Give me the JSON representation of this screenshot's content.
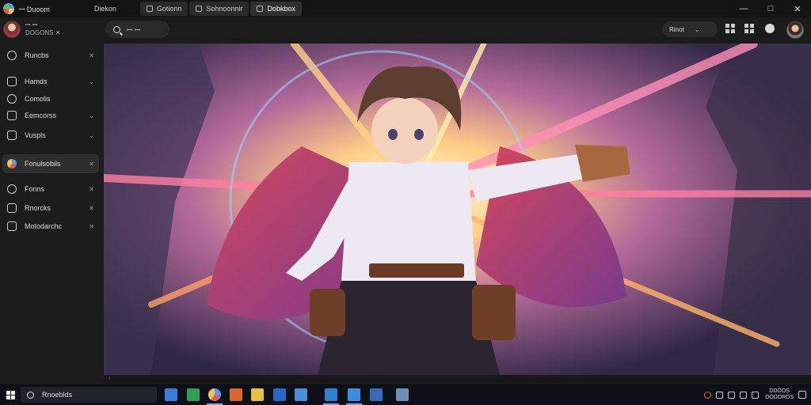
{
  "titlebar": {
    "app_name": "ꟷ Duoom",
    "tabs": [
      {
        "label": "Diekon"
      },
      {
        "label": "Gotionn"
      },
      {
        "label": "Sohnoonnir"
      },
      {
        "label": "Dobkbox"
      }
    ],
    "controls": {
      "minimize": "—",
      "maximize": "□",
      "close": "✕"
    }
  },
  "profile": {
    "name": "ꟷ ꟷ",
    "subtitle": "DOGONS ✕"
  },
  "sidebar": {
    "items": [
      {
        "label": "Runcbs",
        "icon": "history-icon",
        "caret": "✕"
      },
      {
        "label": "Hamds",
        "icon": "star-icon",
        "caret": "⌄"
      },
      {
        "label": "Comolis",
        "icon": "circle-icon",
        "caret": ""
      },
      {
        "label": "Eemcorss",
        "icon": "folder-icon",
        "caret": "⌄"
      },
      {
        "label": "Vuspls",
        "icon": "tag-icon",
        "caret": "⌄"
      },
      {
        "label": "Fonulsobils",
        "icon": "globe-icon",
        "caret": "✕"
      },
      {
        "label": "Fonns",
        "icon": "palette-icon",
        "caret": "✕"
      },
      {
        "label": "Rnorcks",
        "icon": "puzzle-icon",
        "caret": "✕"
      },
      {
        "label": "Motodarchc",
        "icon": "shield-icon",
        "caret": "✕"
      }
    ]
  },
  "header": {
    "search_placeholder": "ꟷ ꟷ",
    "filter_label": "Rinot",
    "filter_caret": "⌄"
  },
  "taskbar": {
    "search_text": "Rnoeblds",
    "clock_time": "DDOOS",
    "clock_date": "DODORDS"
  },
  "colors": {
    "accent": "#6aa6ff",
    "sidebar_bg": "#1c1c1c",
    "titlebar_bg": "#141414",
    "taskbar_bg": "#0d1017"
  }
}
